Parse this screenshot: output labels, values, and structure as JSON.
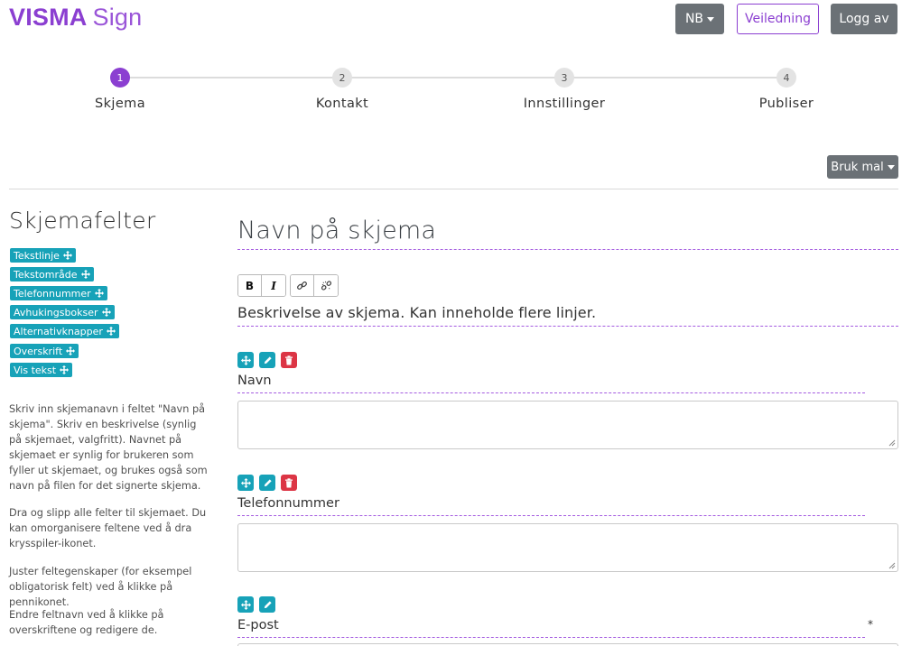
{
  "header": {
    "logo_brand": "VISMA",
    "logo_product": "Sign",
    "lang_button": "NB",
    "guide_button": "Veiledning",
    "logout_button": "Logg av"
  },
  "stepper": {
    "steps": [
      {
        "number": "1",
        "label": "Skjema",
        "active": true
      },
      {
        "number": "2",
        "label": "Kontakt",
        "active": false
      },
      {
        "number": "3",
        "label": "Innstillinger",
        "active": false
      },
      {
        "number": "4",
        "label": "Publiser",
        "active": false
      }
    ]
  },
  "toolbar": {
    "template_button": "Bruk mal"
  },
  "sidebar": {
    "title": "Skjemafelter",
    "field_types": [
      {
        "label": "Tekstlinje"
      },
      {
        "label": "Tekstområde"
      },
      {
        "label": "Telefonnummer"
      },
      {
        "label": "Avhukingsbokser"
      },
      {
        "label": "Alternativknapper"
      },
      {
        "label": "Overskrift"
      },
      {
        "label": "Vis tekst"
      }
    ],
    "help": [
      "Skriv inn skjemanavn i feltet \"Navn på skjema\". Skriv en beskrivelse (synlig på skjemaet, valgfritt). Navnet på skjemaet er synlig for brukeren som fyller ut skjemaet, og brukes også som navn på filen for det signerte skjema.",
      "Dra og slipp alle felter til skjemaet. Du kan omorganisere feltene ved å dra krysspiler-ikonet.",
      "Juster feltegenskaper (for eksempel obligatorisk felt) ved å klikke på pennikonet.",
      "Endre feltnavn ved å klikke på overskriftene og redigere de."
    ]
  },
  "form": {
    "title": "Navn på skjema",
    "editor_buttons": {
      "bold": "B",
      "italic": "I"
    },
    "description": "Beskrivelse av skjema. Kan inneholde flere linjer.",
    "fields": [
      {
        "label": "Navn",
        "required": false
      },
      {
        "label": "Telefonnummer",
        "required": false
      },
      {
        "label": "E-post",
        "required": true,
        "required_mark": "*"
      }
    ]
  },
  "colors": {
    "brand": "#8b3fd1",
    "teal": "#17a2b8",
    "danger": "#dc3545",
    "gray_button": "#6b7176"
  }
}
